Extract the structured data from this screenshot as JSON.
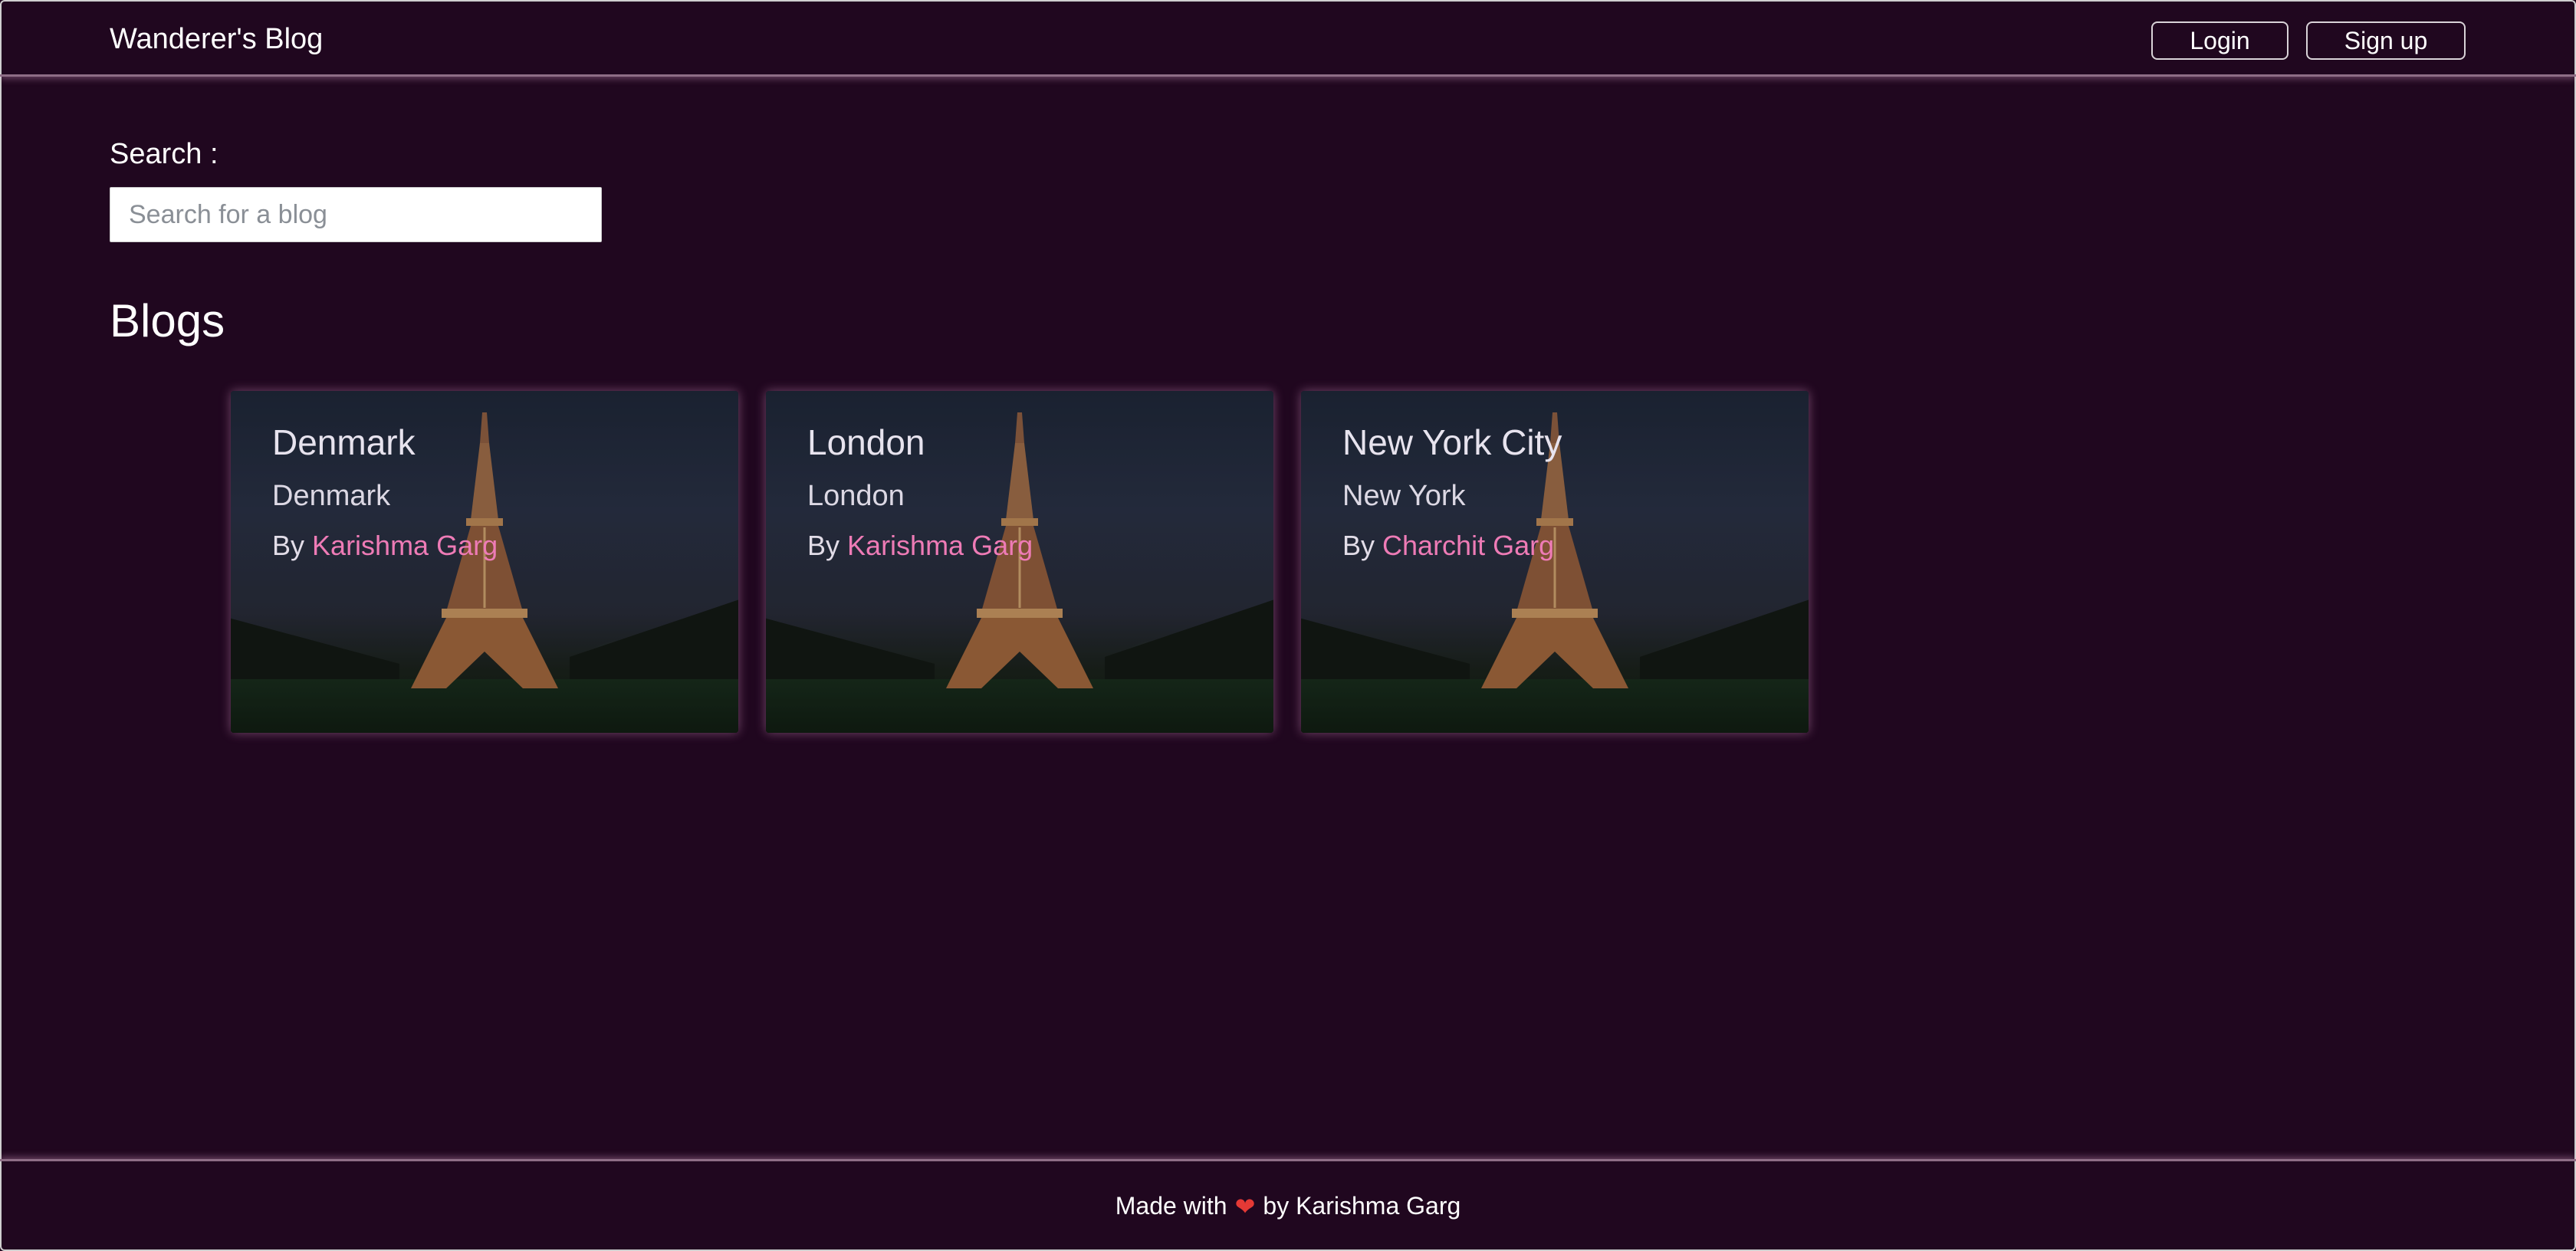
{
  "header": {
    "brand": "Wanderer's Blog",
    "login_label": "Login",
    "signup_label": "Sign up"
  },
  "search": {
    "label": "Search :",
    "placeholder": "Search for a blog"
  },
  "blogs": {
    "title": "Blogs",
    "cards": [
      {
        "title": "Denmark",
        "subtitle": "Denmark",
        "by": "By",
        "author": "Karishma Garg"
      },
      {
        "title": "London",
        "subtitle": "London",
        "by": "By",
        "author": "Karishma Garg"
      },
      {
        "title": "New York City",
        "subtitle": "New York",
        "by": "By",
        "author": "Charchit Garg"
      }
    ]
  },
  "footer": {
    "made_with": "Made with",
    "heart_icon": "heart-icon",
    "by_text": "by Karishma Garg"
  },
  "colors": {
    "background": "#20071f",
    "accent_link": "#ee7bb6",
    "divider": "#8e6e86"
  }
}
